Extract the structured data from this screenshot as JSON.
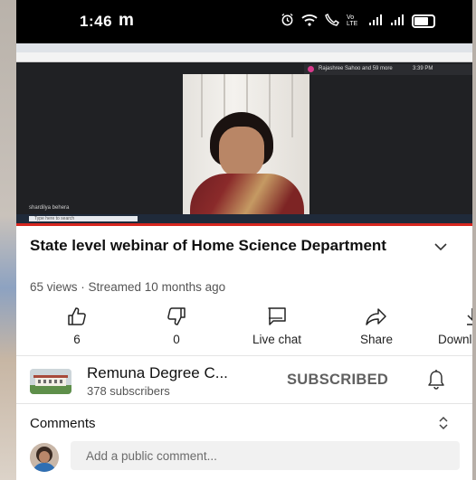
{
  "status_bar": {
    "time": "1:46",
    "app_letter": "m",
    "network_label": "Vo LTE"
  },
  "video": {
    "meet_label": "Rajashree Sahoo and 59 more",
    "self_name": "shardilya behera",
    "taskbar_search": "Type here to search",
    "clock": "3:39 PM"
  },
  "title": "State level webinar of Home Science Department",
  "meta": "65 views · Streamed 10 months ago",
  "actions": {
    "like_count": "6",
    "dislike_count": "0",
    "live_chat": "Live chat",
    "share": "Share",
    "download": "Download"
  },
  "channel": {
    "name": "Remuna Degree C...",
    "subscribers": "378 subscribers",
    "subscribed_label": "SUBSCRIBED"
  },
  "comments": {
    "heading": "Comments",
    "placeholder": "Add a public comment..."
  },
  "colors": {
    "accent_red": "#d6261f",
    "text": "#111111",
    "secondary": "#606060"
  }
}
